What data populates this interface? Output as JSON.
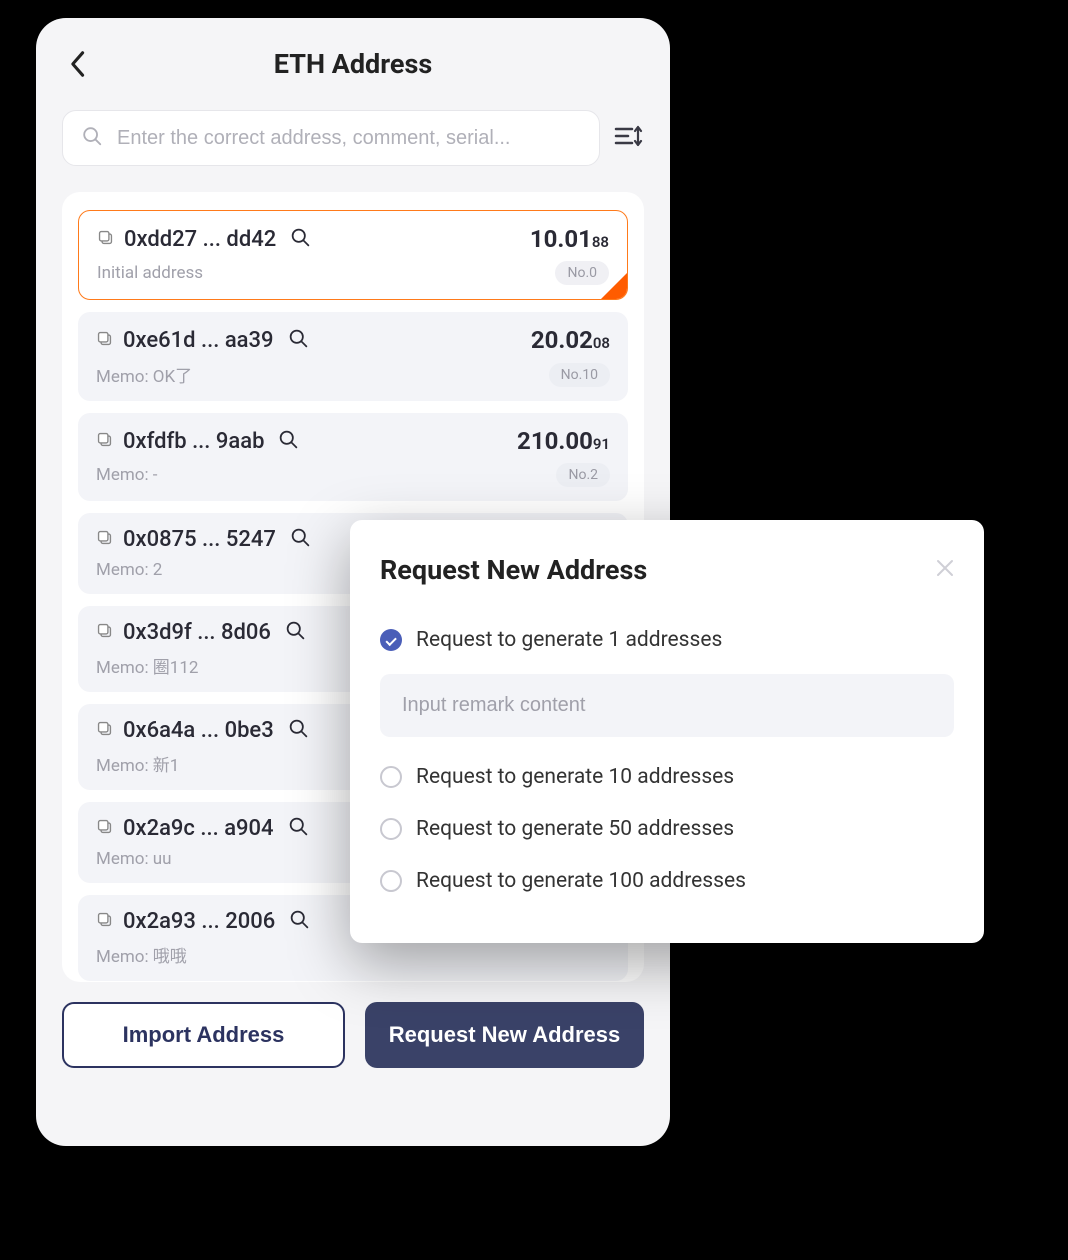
{
  "header": {
    "title": "ETH Address"
  },
  "search": {
    "placeholder": "Enter the correct address, comment, serial..."
  },
  "addresses": [
    {
      "addr": "0xdd27 ... dd42",
      "balance_int": "10.01",
      "balance_dec": "88",
      "memo": "Initial address",
      "badge": "No.0",
      "selected": true
    },
    {
      "addr": "0xe61d ... aa39",
      "balance_int": "20.02",
      "balance_dec": "08",
      "memo": "Memo: OK了",
      "badge": "No.10",
      "selected": false
    },
    {
      "addr": "0xfdfb ... 9aab",
      "balance_int": "210.00",
      "balance_dec": "91",
      "memo": "Memo: -",
      "badge": "No.2",
      "selected": false
    },
    {
      "addr": "0x0875 ... 5247",
      "balance_int": "",
      "balance_dec": "",
      "memo": "Memo: 2",
      "badge": "",
      "selected": false
    },
    {
      "addr": "0x3d9f ... 8d06",
      "balance_int": "",
      "balance_dec": "",
      "memo": "Memo: 圈112",
      "badge": "",
      "selected": false
    },
    {
      "addr": "0x6a4a ... 0be3",
      "balance_int": "",
      "balance_dec": "",
      "memo": "Memo: 新1",
      "badge": "",
      "selected": false
    },
    {
      "addr": "0x2a9c ... a904",
      "balance_int": "",
      "balance_dec": "",
      "memo": "Memo: uu",
      "badge": "",
      "selected": false
    },
    {
      "addr": "0x2a93 ... 2006",
      "balance_int": "",
      "balance_dec": "",
      "memo": "Memo: 哦哦",
      "badge": "",
      "selected": false
    }
  ],
  "buttons": {
    "import": "Import Address",
    "request": "Request New Address"
  },
  "modal": {
    "title": "Request New Address",
    "remark_placeholder": "Input remark content",
    "options": [
      {
        "label": "Request to generate 1 addresses",
        "checked": true
      },
      {
        "label": "Request to generate 10 addresses",
        "checked": false
      },
      {
        "label": "Request to generate 50 addresses",
        "checked": false
      },
      {
        "label": "Request to generate 100 addresses",
        "checked": false
      }
    ]
  }
}
